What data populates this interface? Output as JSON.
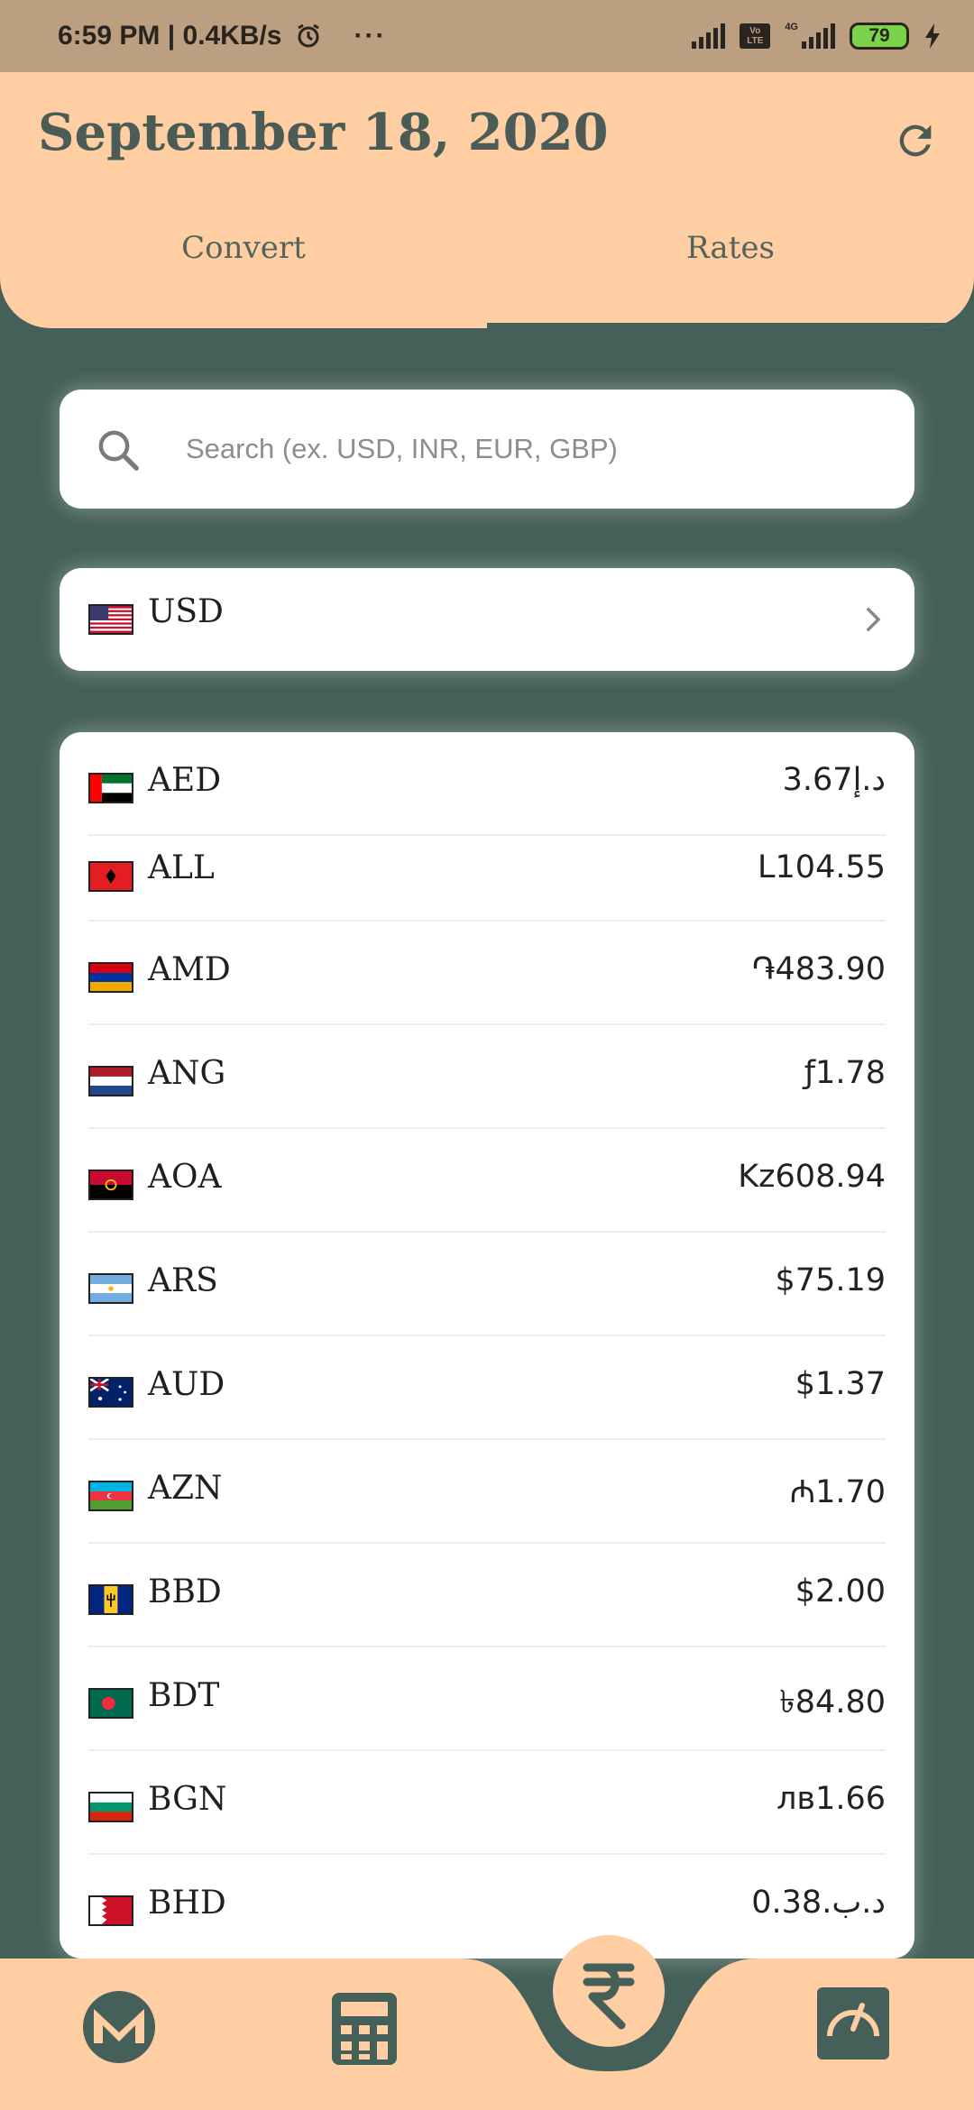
{
  "status_bar": {
    "time": "6:59 PM | 0.4KB/s",
    "more": "···",
    "volte_line1": "Vo",
    "volte_line2": "LTE",
    "net_label": "4G",
    "battery": "79"
  },
  "header": {
    "date": "September 18, 2020",
    "tabs": [
      {
        "label": "Convert"
      },
      {
        "label": "Rates"
      }
    ],
    "active_tab": "Rates"
  },
  "search": {
    "placeholder": "Search (ex. USD, INR, EUR, GBP)",
    "value": ""
  },
  "base_currency": {
    "code": "USD"
  },
  "rates": [
    {
      "code": "AED",
      "value": "3.67د.إ"
    },
    {
      "code": "ALL",
      "value": "L104.55"
    },
    {
      "code": "AMD",
      "value": "֏483.90"
    },
    {
      "code": "ANG",
      "value": "ƒ1.78"
    },
    {
      "code": "AOA",
      "value": "Kz608.94"
    },
    {
      "code": "ARS",
      "value": "$75.19"
    },
    {
      "code": "AUD",
      "value": "$1.37"
    },
    {
      "code": "AZN",
      "value": "₼1.70"
    },
    {
      "code": "BBD",
      "value": "$2.00"
    },
    {
      "code": "BDT",
      "value": "৳84.80"
    },
    {
      "code": "BGN",
      "value": "лв1.66"
    },
    {
      "code": "BHD",
      "value": "0.38.د.ب"
    }
  ],
  "colors": {
    "background": "#456059",
    "header": "#ffcfa3",
    "status_bar": "#bc9e80",
    "accent_dark": "#456059",
    "battery_green": "#7bd34c"
  },
  "icons": {
    "refresh": "refresh-icon",
    "search": "search-icon",
    "chevron": "chevron-right-icon",
    "nav": [
      "monero-icon",
      "calculator-icon",
      "rupee-icon",
      "gauge-icon"
    ]
  }
}
